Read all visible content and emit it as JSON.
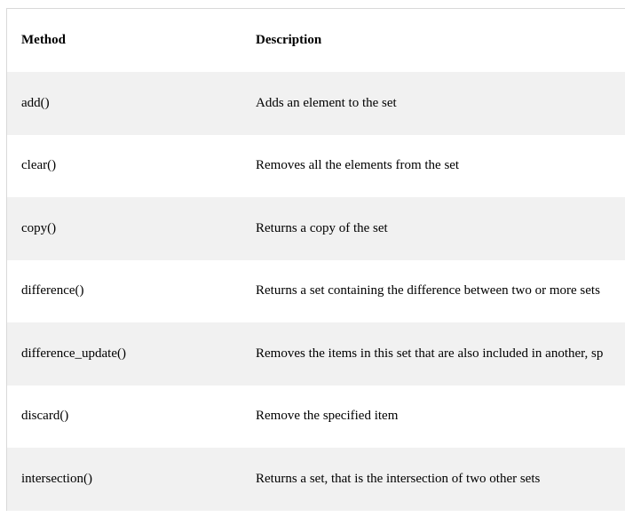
{
  "table": {
    "headers": {
      "method": "Method",
      "description": "Description"
    },
    "rows": [
      {
        "method": "add()",
        "description": "Adds an element to the set"
      },
      {
        "method": "clear()",
        "description": "Removes all the elements from the set"
      },
      {
        "method": "copy()",
        "description": "Returns a copy of the set"
      },
      {
        "method": "difference()",
        "description": "Returns a set containing the difference between two or more sets"
      },
      {
        "method": "difference_update()",
        "description": "Removes the items in this set that are also included in another, sp"
      },
      {
        "method": "discard()",
        "description": "Remove the specified item"
      },
      {
        "method": "intersection()",
        "description": "Returns a set, that is the intersection of two other sets"
      }
    ]
  },
  "colors": {
    "shaded_row": "#f1f1f1",
    "border": "#d9d9d9"
  }
}
